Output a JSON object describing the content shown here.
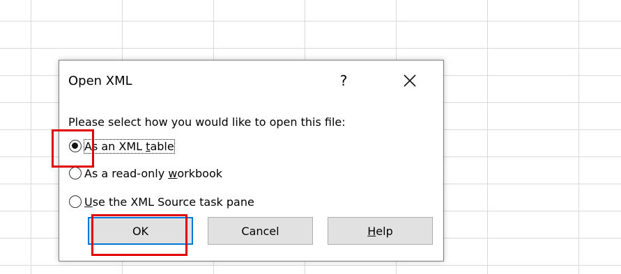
{
  "dialog": {
    "title": "Open XML",
    "help_glyph": "?",
    "close_icon": "close-icon",
    "prompt": "Please select how you would like to open this file:",
    "options": [
      {
        "pre": "As an XML ",
        "mnemonic": "t",
        "post": "able",
        "selected": true
      },
      {
        "pre": "As a read-only ",
        "mnemonic": "w",
        "post": "orkbook",
        "selected": false
      },
      {
        "pre": "",
        "mnemonic": "U",
        "post": "se the XML Source task pane",
        "selected": false
      }
    ],
    "buttons": {
      "ok": "OK",
      "cancel": "Cancel",
      "help_pre": "",
      "help_mnemonic": "H",
      "help_post": "elp"
    }
  },
  "colors": {
    "highlight": "#e00000",
    "default_button_border": "#0078d7",
    "grid_line": "#d9d9d9",
    "button_face": "#e1e1e1"
  }
}
